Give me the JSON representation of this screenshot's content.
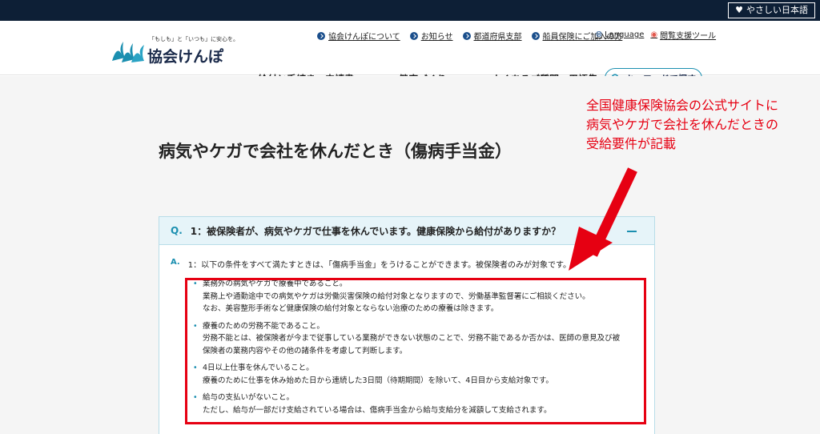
{
  "topbar": {
    "easy_japanese": "やさしい日本語"
  },
  "logo": {
    "tagline": "「もしも」と「いつも」に安心を。",
    "name": "協会けんぽ"
  },
  "utility_links": [
    {
      "label": "協会けんぽについて"
    },
    {
      "label": "お知らせ"
    },
    {
      "label": "都道府県支部"
    },
    {
      "label": "船員保険にご加入の方"
    }
  ],
  "utility_right": {
    "language": "Language",
    "accessibility": "閲覧支援ツール"
  },
  "main_nav": [
    {
      "label": "給付と手続き・申請書"
    },
    {
      "label": "健康づくり"
    },
    {
      "label": "よくあるご質問・用語集"
    }
  ],
  "search": {
    "label": "キーワードで探す"
  },
  "page": {
    "title": "病気やケガで会社を休んだとき（傷病手当金）"
  },
  "qa": {
    "q_mark": "Q.",
    "question": "1：被保険者が、病気やケガで仕事を休んでいます。健康保険から給付がありますか？",
    "a_mark": "A.",
    "answer": "1：以下の条件をすべて満たすときは、「傷病手当金」をうけることができます。被保険者のみが対象です。",
    "conditions": [
      {
        "title": "業務外の病気やケガで療養中であること。",
        "lines": [
          "業務上や通勤途中での病気やケガは労働災害保険の給付対象となりますので、労働基準監督署にご相談ください。",
          "なお、美容整形手術など健康保険の給付対象とならない治療のための療養は除きます。"
        ]
      },
      {
        "title": "療養のための労務不能であること。",
        "lines": [
          "労務不能とは、被保険者が今まで従事している業務ができない状態のことで、労務不能であるか否かは、医師の意見及び被",
          "保険者の業務内容やその他の諸条件を考慮して判断します。"
        ]
      },
      {
        "title": "4日以上仕事を休んでいること。",
        "lines": [
          "療養のために仕事を休み始めた日から連続した3日間（待期期間）を除いて、4日目から支給対象です。"
        ]
      },
      {
        "title": "給与の支払いがないこと。",
        "lines": [
          "ただし、給与が一部だけ支給されている場合は、傷病手当金から給与支給分を減額して支給されます。"
        ]
      }
    ]
  },
  "annotation": {
    "lines": [
      "全国健康保険協会の公式サイトに",
      "病気やケガで会社を休んだときの",
      "受給要件が記載"
    ]
  },
  "colors": {
    "topbar": "#0d1f36",
    "accent": "#1b8fb0",
    "highlight": "#e60012"
  }
}
